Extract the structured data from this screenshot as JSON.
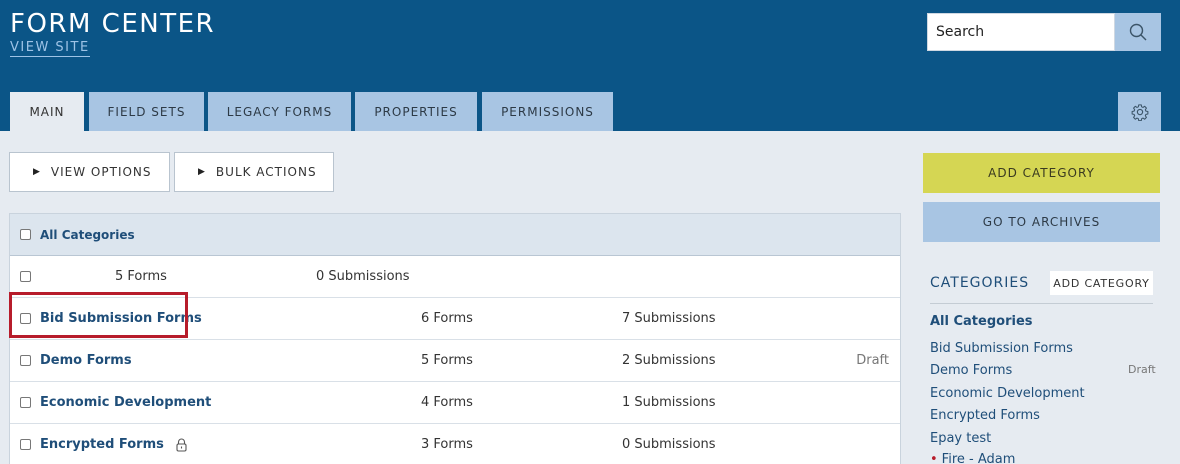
{
  "header": {
    "title": "FORM CENTER",
    "view_site": "VIEW SITE",
    "search": {
      "placeholder": "Search",
      "icon": "search-icon"
    },
    "settings_icon": "gear-icon"
  },
  "tabs": [
    {
      "label": "MAIN",
      "active": true
    },
    {
      "label": "FIELD SETS",
      "active": false
    },
    {
      "label": "LEGACY FORMS",
      "active": false
    },
    {
      "label": "PROPERTIES",
      "active": false
    },
    {
      "label": "PERMISSIONS",
      "active": false
    }
  ],
  "toolbar": {
    "view_options": "VIEW OPTIONS",
    "bulk_actions": "BULK ACTIONS"
  },
  "table": {
    "header": "All Categories",
    "rows": [
      {
        "name": "",
        "forms": "5  Forms",
        "submissions": "0  Submissions",
        "status": ""
      },
      {
        "name": "Bid Submission Forms",
        "forms": "6  Forms",
        "submissions": "7  Submissions",
        "status": ""
      },
      {
        "name": "Demo Forms",
        "forms": "5  Forms",
        "submissions": "2  Submissions",
        "status": "Draft"
      },
      {
        "name": "Economic Development",
        "forms": "4  Forms",
        "submissions": "1  Submissions",
        "status": ""
      },
      {
        "name": "Encrypted Forms",
        "forms": "3  Forms",
        "submissions": "0  Submissions",
        "status": "",
        "icon": "lock-icon"
      }
    ]
  },
  "sidebar": {
    "add_category": "ADD CATEGORY",
    "go_to_archives": "GO TO ARCHIVES",
    "categories_heading": "CATEGORIES",
    "add_category_small": "ADD CATEGORY",
    "items": [
      {
        "label": "All Categories"
      },
      {
        "label": "Bid Submission Forms"
      },
      {
        "label": "Demo Forms",
        "status": "Draft"
      },
      {
        "label": "Economic Development"
      },
      {
        "label": "Encrypted Forms"
      },
      {
        "label": "Epay test"
      },
      {
        "label": "Fire - Adam"
      }
    ]
  },
  "colors": {
    "header_bg": "#0b5587",
    "tab_bg": "#a8c5e3",
    "accent_yellow": "#d5d653",
    "link": "#1f4e79",
    "highlight": "#b71c2b"
  }
}
